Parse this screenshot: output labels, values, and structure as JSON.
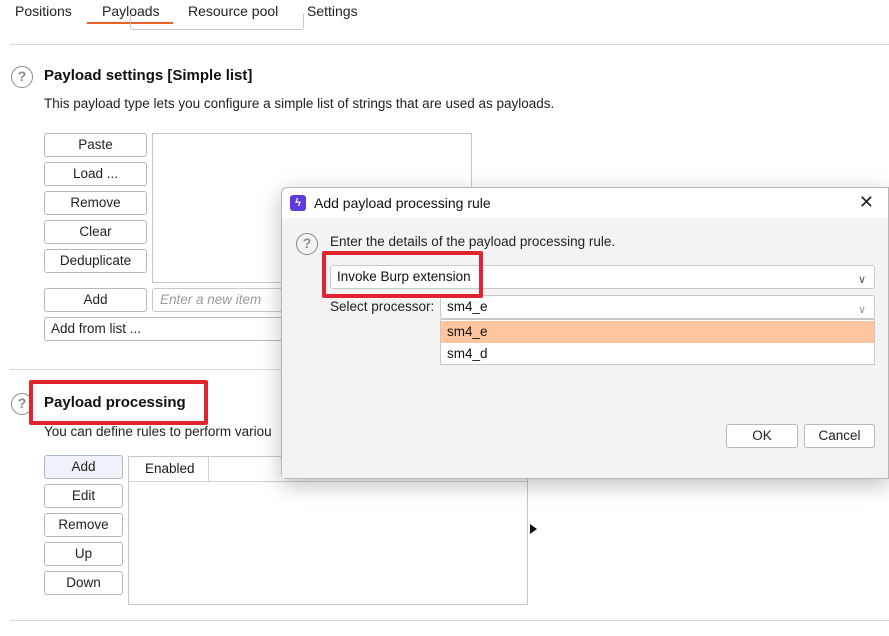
{
  "tabs": [
    {
      "label": "Positions"
    },
    {
      "label": "Payloads"
    },
    {
      "label": "Resource pool"
    },
    {
      "label": "Settings"
    }
  ],
  "active_tab": "Payloads",
  "payload_settings": {
    "title": "Payload settings [Simple list]",
    "description": "This payload type lets you configure a simple list of strings that are used as payloads.",
    "buttons": {
      "paste": "Paste",
      "load": "Load ...",
      "remove": "Remove",
      "clear": "Clear",
      "deduplicate": "Deduplicate",
      "add": "Add",
      "add_from_list": "Add from list ..."
    },
    "new_item_placeholder": "Enter a new item"
  },
  "payload_processing": {
    "title": "Payload processing",
    "description": "You can define rules to perform variou",
    "buttons": {
      "add": "Add",
      "edit": "Edit",
      "remove": "Remove",
      "up": "Up",
      "down": "Down"
    },
    "table_header": "Enabled"
  },
  "dialog": {
    "title": "Add payload processing rule",
    "close_glyph": "✕",
    "prompt": "Enter the details of the payload processing rule.",
    "rule_type": "Invoke Burp extension",
    "processor_label": "Select processor:",
    "processor_value": "sm4_e",
    "options": [
      "sm4_e",
      "sm4_d"
    ],
    "selected_option": "sm4_e",
    "ok": "OK",
    "cancel": "Cancel"
  },
  "icons": {
    "help": "question-circle-icon",
    "chevron": "chevron-down-icon",
    "burp": "burp-logo-icon"
  },
  "colors": {
    "accent": "#e8602c",
    "highlight_box": "#e0242f",
    "dropdown_selection": "#ffc59e",
    "burp_icon": "#5d3be0"
  }
}
